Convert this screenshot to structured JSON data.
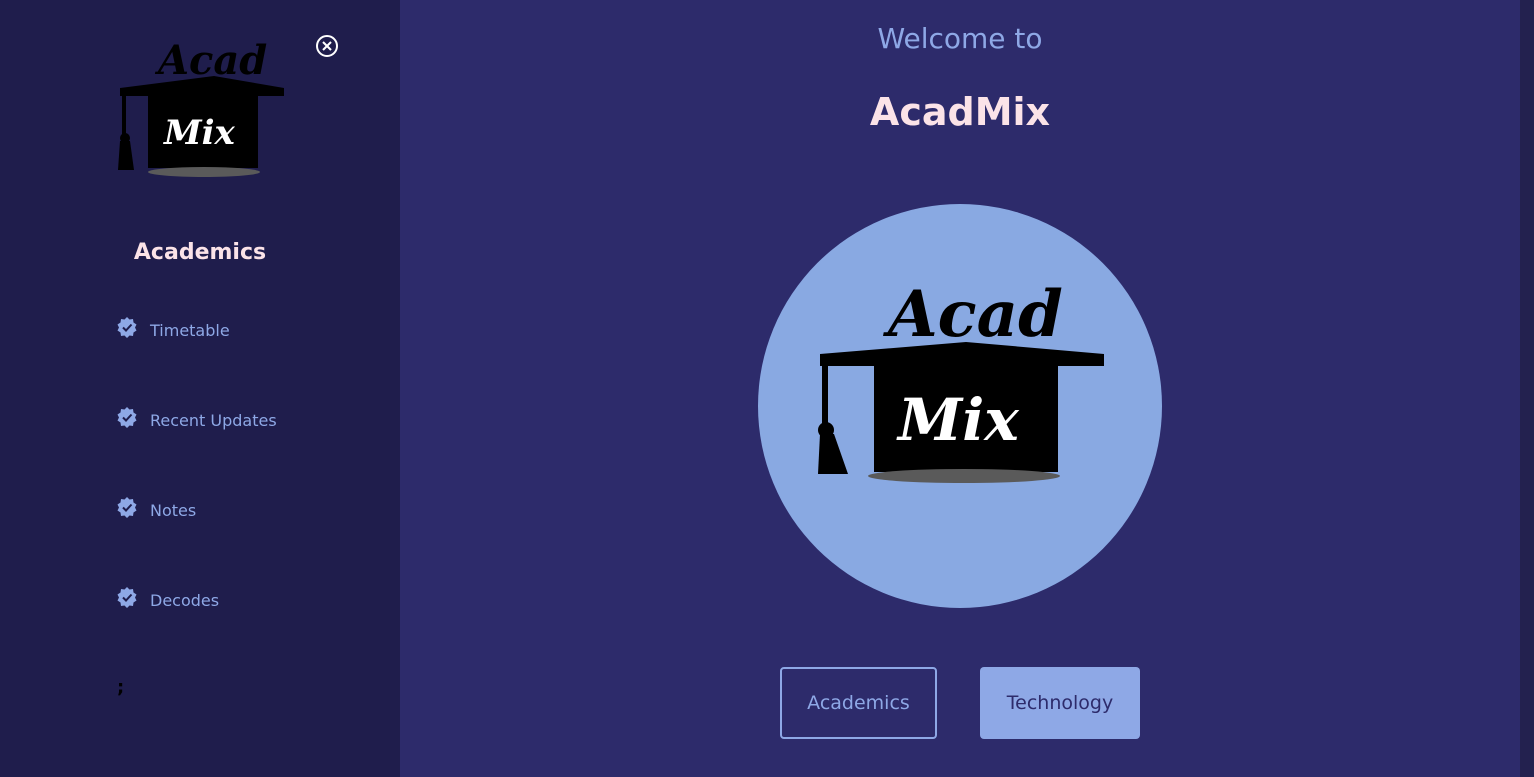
{
  "sidebar": {
    "logo": {
      "top_text": "Acad",
      "bottom_text": "Mix"
    },
    "close_icon": "close-circle-icon",
    "heading": "Academics",
    "items": [
      {
        "label": "Timetable",
        "icon": "verified-badge-icon"
      },
      {
        "label": "Recent Updates",
        "icon": "verified-badge-icon"
      },
      {
        "label": "Notes",
        "icon": "verified-badge-icon"
      },
      {
        "label": "Decodes",
        "icon": "verified-badge-icon"
      }
    ],
    "stray_text": ";"
  },
  "main": {
    "welcome": "Welcome to",
    "title": "AcadMix",
    "hero_logo": {
      "top_text": "Acad",
      "bottom_text": "Mix"
    },
    "buttons": {
      "academics": "Academics",
      "technology": "Technology"
    }
  },
  "colors": {
    "sidebar_bg": "#1f1d4c",
    "main_bg": "#2d2b6b",
    "accent": "#8ea8e6",
    "title": "#fbe3e8",
    "circle": "#89a9e2"
  }
}
